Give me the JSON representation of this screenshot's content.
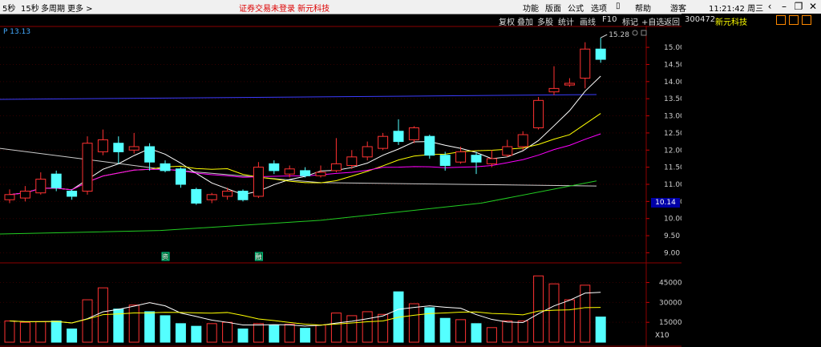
{
  "titlebar": {
    "left_items": [
      "5秒",
      "15秒",
      "多周期",
      "更多 >"
    ],
    "notice": "证券交易未登录  新元科技",
    "menu": [
      "功能",
      "版面",
      "公式",
      "选项",
      "帮助"
    ],
    "guest": "游客",
    "clock": "11:21:42 周三"
  },
  "toolbar": {
    "items": [
      "复权",
      "叠加",
      "多股",
      "统计",
      "画线",
      "F10",
      "标记",
      "+自选",
      "返回"
    ]
  },
  "stock": {
    "code": "300472",
    "name": "新元科技"
  },
  "date_label": "P 13.13",
  "last_price": "10.14",
  "x10": "X10",
  "colors": {
    "up": "#ff3232",
    "down": "#54ffff",
    "bg": "#000000",
    "grid": "#8b0000"
  },
  "chart_data": {
    "type": "candlestick",
    "price_axis": {
      "ticks": [
        "15.00",
        "14.50",
        "14.00",
        "13.50",
        "13.00",
        "12.50",
        "12.00",
        "11.50",
        "11.00",
        "10.50",
        "10.00",
        "9.50",
        "9.00"
      ],
      "range": [
        8.8,
        15.4
      ]
    },
    "volume_axis": {
      "ticks": [
        "45000",
        "30000",
        "15000"
      ],
      "range": [
        0,
        55000
      ]
    },
    "max_label": "15.28",
    "candles": [
      {
        "o": 10.55,
        "c": 10.7,
        "h": 10.85,
        "l": 10.45,
        "v": 16000
      },
      {
        "o": 10.6,
        "c": 10.8,
        "h": 10.95,
        "l": 10.5,
        "v": 15000
      },
      {
        "o": 10.75,
        "c": 11.15,
        "h": 11.35,
        "l": 10.7,
        "v": 15500
      },
      {
        "o": 11.3,
        "c": 10.9,
        "h": 11.4,
        "l": 10.8,
        "v": 16000
      },
      {
        "o": 10.8,
        "c": 10.65,
        "h": 10.85,
        "l": 10.55,
        "v": 10000
      },
      {
        "o": 10.8,
        "c": 12.2,
        "h": 12.4,
        "l": 10.7,
        "v": 32000
      },
      {
        "o": 11.95,
        "c": 12.3,
        "h": 12.6,
        "l": 11.85,
        "v": 41000
      },
      {
        "o": 12.2,
        "c": 11.95,
        "h": 12.4,
        "l": 11.6,
        "v": 25000
      },
      {
        "o": 12.0,
        "c": 12.1,
        "h": 12.5,
        "l": 11.9,
        "v": 28000
      },
      {
        "o": 12.1,
        "c": 11.65,
        "h": 12.2,
        "l": 11.4,
        "v": 23000
      },
      {
        "o": 11.6,
        "c": 11.4,
        "h": 11.7,
        "l": 11.35,
        "v": 20000
      },
      {
        "o": 11.45,
        "c": 11.0,
        "h": 11.5,
        "l": 10.9,
        "v": 14000
      },
      {
        "o": 10.85,
        "c": 10.45,
        "h": 10.9,
        "l": 10.4,
        "v": 12000
      },
      {
        "o": 10.55,
        "c": 10.7,
        "h": 10.75,
        "l": 10.45,
        "v": 14000
      },
      {
        "o": 10.65,
        "c": 10.8,
        "h": 10.9,
        "l": 10.55,
        "v": 15000
      },
      {
        "o": 10.8,
        "c": 10.55,
        "h": 10.85,
        "l": 10.5,
        "v": 10000
      },
      {
        "o": 10.65,
        "c": 11.5,
        "h": 11.65,
        "l": 10.6,
        "v": 14000
      },
      {
        "o": 11.6,
        "c": 11.4,
        "h": 11.7,
        "l": 11.3,
        "v": 13000
      },
      {
        "o": 11.3,
        "c": 11.45,
        "h": 11.55,
        "l": 11.2,
        "v": 13500
      },
      {
        "o": 11.4,
        "c": 11.25,
        "h": 11.5,
        "l": 11.2,
        "v": 10500
      },
      {
        "o": 11.25,
        "c": 11.35,
        "h": 11.55,
        "l": 11.2,
        "v": 13000
      },
      {
        "o": 11.4,
        "c": 11.6,
        "h": 12.35,
        "l": 11.35,
        "v": 22000
      },
      {
        "o": 11.55,
        "c": 11.8,
        "h": 12.0,
        "l": 11.45,
        "v": 20000
      },
      {
        "o": 11.8,
        "c": 12.1,
        "h": 12.25,
        "l": 11.7,
        "v": 23000
      },
      {
        "o": 12.05,
        "c": 12.4,
        "h": 12.5,
        "l": 12.0,
        "v": 21000
      },
      {
        "o": 12.55,
        "c": 12.25,
        "h": 12.9,
        "l": 12.15,
        "v": 38000
      },
      {
        "o": 12.3,
        "c": 12.65,
        "h": 12.7,
        "l": 12.2,
        "v": 29000
      },
      {
        "o": 12.4,
        "c": 11.85,
        "h": 12.45,
        "l": 11.75,
        "v": 26000
      },
      {
        "o": 11.85,
        "c": 11.55,
        "h": 11.95,
        "l": 11.4,
        "v": 18000
      },
      {
        "o": 11.65,
        "c": 11.95,
        "h": 12.1,
        "l": 11.6,
        "v": 17000
      },
      {
        "o": 11.85,
        "c": 11.65,
        "h": 11.95,
        "l": 11.3,
        "v": 14000
      },
      {
        "o": 11.6,
        "c": 11.75,
        "h": 12.0,
        "l": 11.5,
        "v": 11000
      },
      {
        "o": 11.85,
        "c": 12.1,
        "h": 12.3,
        "l": 11.8,
        "v": 16000
      },
      {
        "o": 12.1,
        "c": 12.45,
        "h": 12.55,
        "l": 12.0,
        "v": 16000
      },
      {
        "o": 12.65,
        "c": 13.45,
        "h": 13.55,
        "l": 12.6,
        "v": 50000
      },
      {
        "o": 13.7,
        "c": 13.8,
        "h": 14.45,
        "l": 13.6,
        "v": 44000
      },
      {
        "o": 13.9,
        "c": 13.95,
        "h": 14.1,
        "l": 13.85,
        "v": 32000
      },
      {
        "o": 14.1,
        "c": 14.95,
        "h": 15.15,
        "l": 13.8,
        "v": 43000
      },
      {
        "o": 14.95,
        "c": 14.65,
        "h": 15.28,
        "l": 14.55,
        "v": 19000
      }
    ],
    "events": [
      "资",
      "融"
    ]
  }
}
